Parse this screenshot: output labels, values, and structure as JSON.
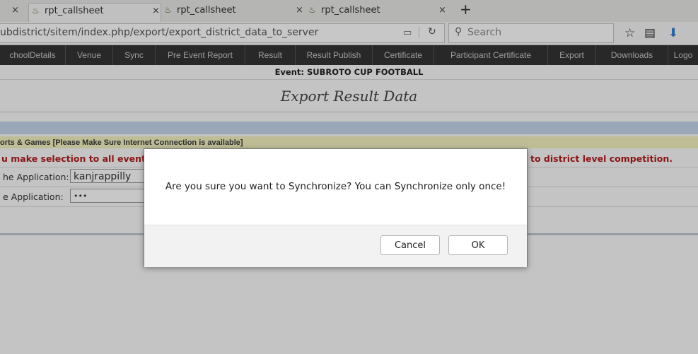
{
  "browser": {
    "tabs": [
      {
        "title": "",
        "close": "×"
      },
      {
        "title": "rpt_callsheet",
        "close": "×"
      },
      {
        "title": "rpt_callsheet",
        "close": "×"
      },
      {
        "title": "rpt_callsheet",
        "close": "×"
      }
    ],
    "new_tab": "+",
    "url": "ubdistrict/sitem/index.php/export/export_district_data_to_server",
    "search_placeholder": "Search",
    "icons": [
      "reader-view-icon",
      "reload-icon",
      "bookmark-star-icon",
      "library-icon",
      "download-icon"
    ]
  },
  "menu": {
    "items": [
      "choolDetails",
      "Venue",
      "Sync",
      "Pre Event Report",
      "Result",
      "Result Publish",
      "Certificate",
      "Participant Certificate",
      "Export",
      "Downloads",
      "Logo"
    ]
  },
  "page": {
    "event_label": "Event: SUBROTO CUP FOOTBALL",
    "heading": "Export Result Data",
    "notice": "orts & Games [Please Make Sure Internet Connection is available]",
    "warning_left": "u make selection to all events .",
    "warning_right": "to district level competition.",
    "fields": [
      {
        "label": "he Application:",
        "value": "kanjrappilly"
      },
      {
        "label": "e Application:",
        "value": "•••"
      }
    ]
  },
  "dialog": {
    "message": "Are you sure you want to Synchronize? You can Synchronize only once!",
    "cancel": "Cancel",
    "ok": "OK"
  },
  "colors": {
    "menubar_bg": "#343434",
    "warning_text": "#b21b1b",
    "notice_bg": "#f4f2c0",
    "band_bg": "#c6d7ee"
  }
}
